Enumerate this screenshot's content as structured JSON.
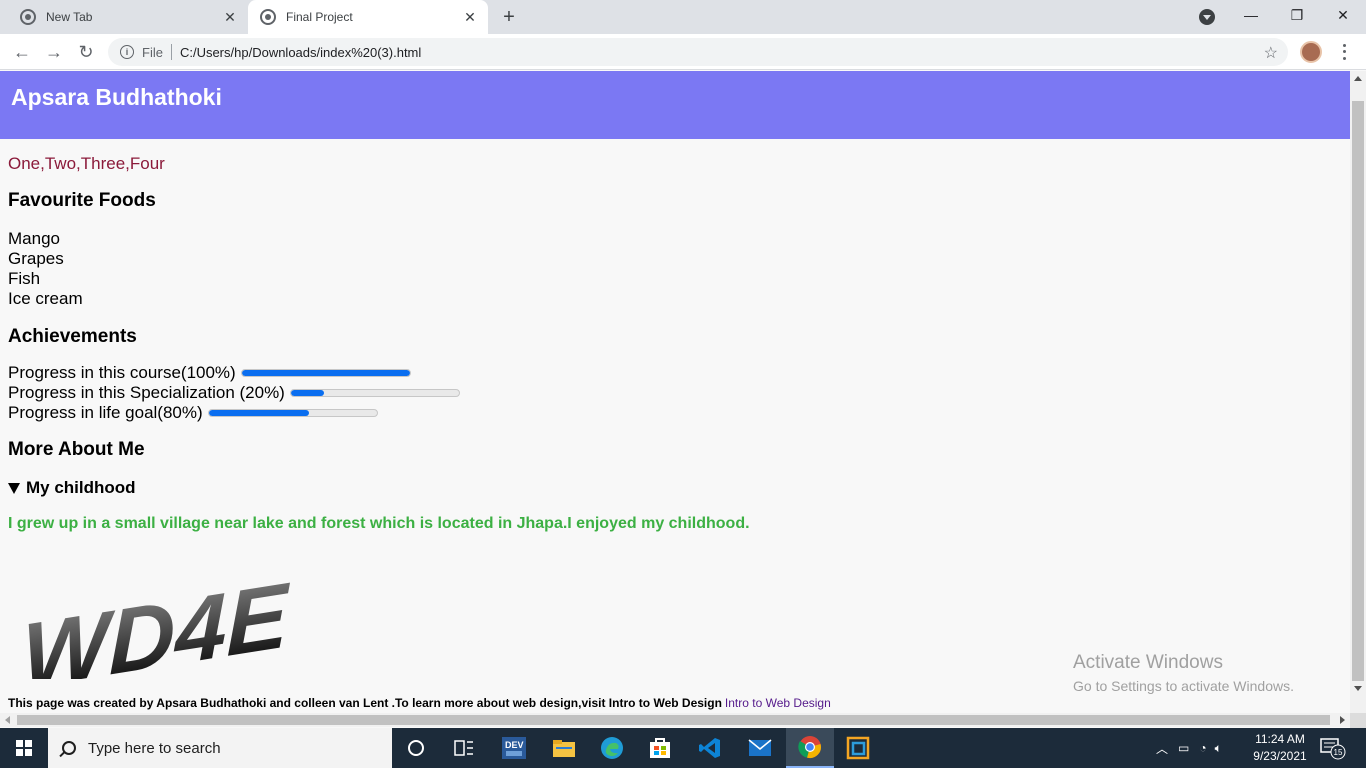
{
  "browser": {
    "tabs": [
      {
        "title": "New Tab",
        "active": false
      },
      {
        "title": "Final Project",
        "active": true
      }
    ],
    "new_tab_label": "+",
    "address": {
      "scheme_label": "File",
      "url": "C:/Users/hp/Downloads/index%20(3).html"
    },
    "window_controls": {
      "minimize": "—",
      "restore": "❐",
      "close": "✕"
    }
  },
  "page": {
    "title": "Apsara Budhathoki",
    "numbers_line": "One,Two,Three,Four",
    "favourite_foods": {
      "heading": "Favourite Foods",
      "items": [
        "Mango",
        "Grapes",
        "Fish",
        "Ice cream"
      ]
    },
    "achievements": {
      "heading": "Achievements",
      "items": [
        {
          "label": "Progress in this course(100%)",
          "value": 1.0
        },
        {
          "label": "Progress in this Specialization (20%)",
          "value": 0.2
        },
        {
          "label": "Progress in life goal(80%)",
          "value": 0.6
        }
      ]
    },
    "more_about": {
      "heading": "More About Me",
      "summary": "My childhood",
      "details": "I grew up in a small village near lake and forest which is located in Jhapa.I enjoyed my childhood."
    },
    "logo_text": "WD4E",
    "footer": {
      "text": "This page was created by Apsara Budhathoki and colleen van Lent .To learn more about web design,visit Intro to Web Design",
      "link_text": "Intro to Web Design"
    },
    "watermark": {
      "line1": "Activate Windows",
      "line2": "Go to Settings to activate Windows."
    }
  },
  "taskbar": {
    "search_placeholder": "Type here to search",
    "pinned": [
      "cortana-icon",
      "task-view-icon",
      "dev-icon",
      "file-explorer-icon",
      "edge-icon",
      "store-icon",
      "vscode-icon",
      "mail-icon",
      "chrome-icon",
      "app-icon"
    ],
    "time": "11:24 AM",
    "date": "9/23/2021",
    "notification_count": "15"
  },
  "colors": {
    "header_bg": "#7b78f3",
    "numbers_color": "#8b1a3a",
    "childhood_color": "#3cb043",
    "progress_fill": "#0a6ef0"
  }
}
